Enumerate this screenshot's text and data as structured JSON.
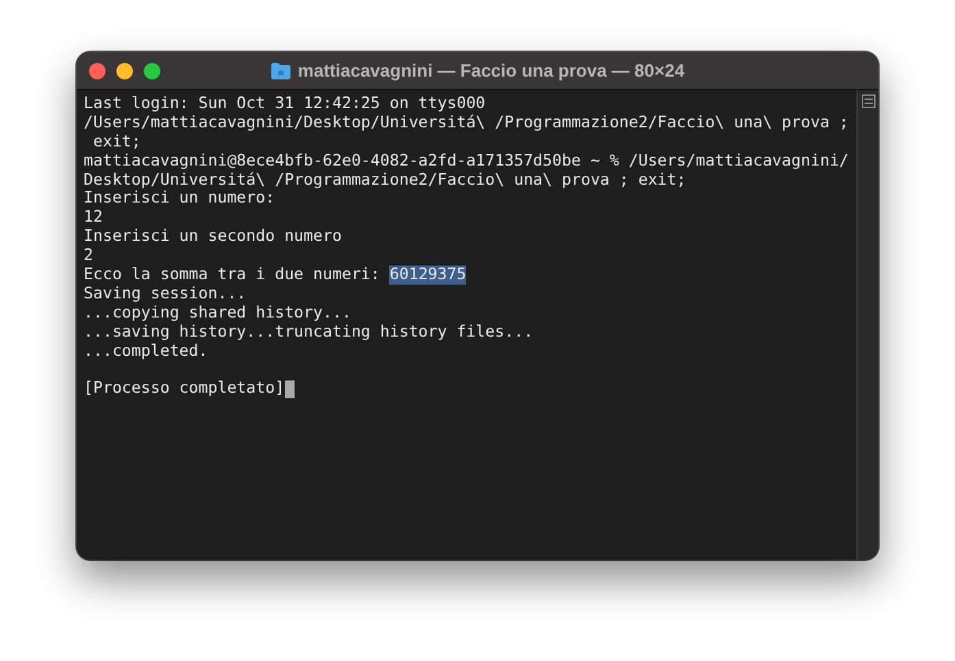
{
  "window": {
    "title": "mattiacavagnini — Faccio una prova — 80×24"
  },
  "terminal": {
    "cursor": true,
    "lines": [
      {
        "kind": "text",
        "text": "Last login: Sun Oct 31 12:42:25 on ttys000"
      },
      {
        "kind": "text",
        "text": "/Users/mattiacavagnini/Desktop/Universitá\\ /Programmazione2/Faccio\\ una\\ prova ;"
      },
      {
        "kind": "text",
        "text": " exit;"
      },
      {
        "kind": "text",
        "text": "mattiacavagnini@8ece4bfb-62e0-4082-a2fd-a171357d50be ~ % /Users/mattiacavagnini/"
      },
      {
        "kind": "text",
        "text": "Desktop/Universitá\\ /Programmazione2/Faccio\\ una\\ prova ; exit;"
      },
      {
        "kind": "text",
        "text": "Inserisci un numero:"
      },
      {
        "kind": "text",
        "text": "12"
      },
      {
        "kind": "text",
        "text": "Inserisci un secondo numero"
      },
      {
        "kind": "text",
        "text": "2"
      },
      {
        "kind": "text",
        "text": "Ecco la somma tra i due numeri: ",
        "selection": "60129375"
      },
      {
        "kind": "text",
        "text": "Saving session..."
      },
      {
        "kind": "text",
        "text": "...copying shared history..."
      },
      {
        "kind": "text",
        "text": "...saving history...truncating history files..."
      },
      {
        "kind": "text",
        "text": "...completed."
      },
      {
        "kind": "blank"
      },
      {
        "kind": "text",
        "text": "[Processo completato]"
      }
    ]
  }
}
